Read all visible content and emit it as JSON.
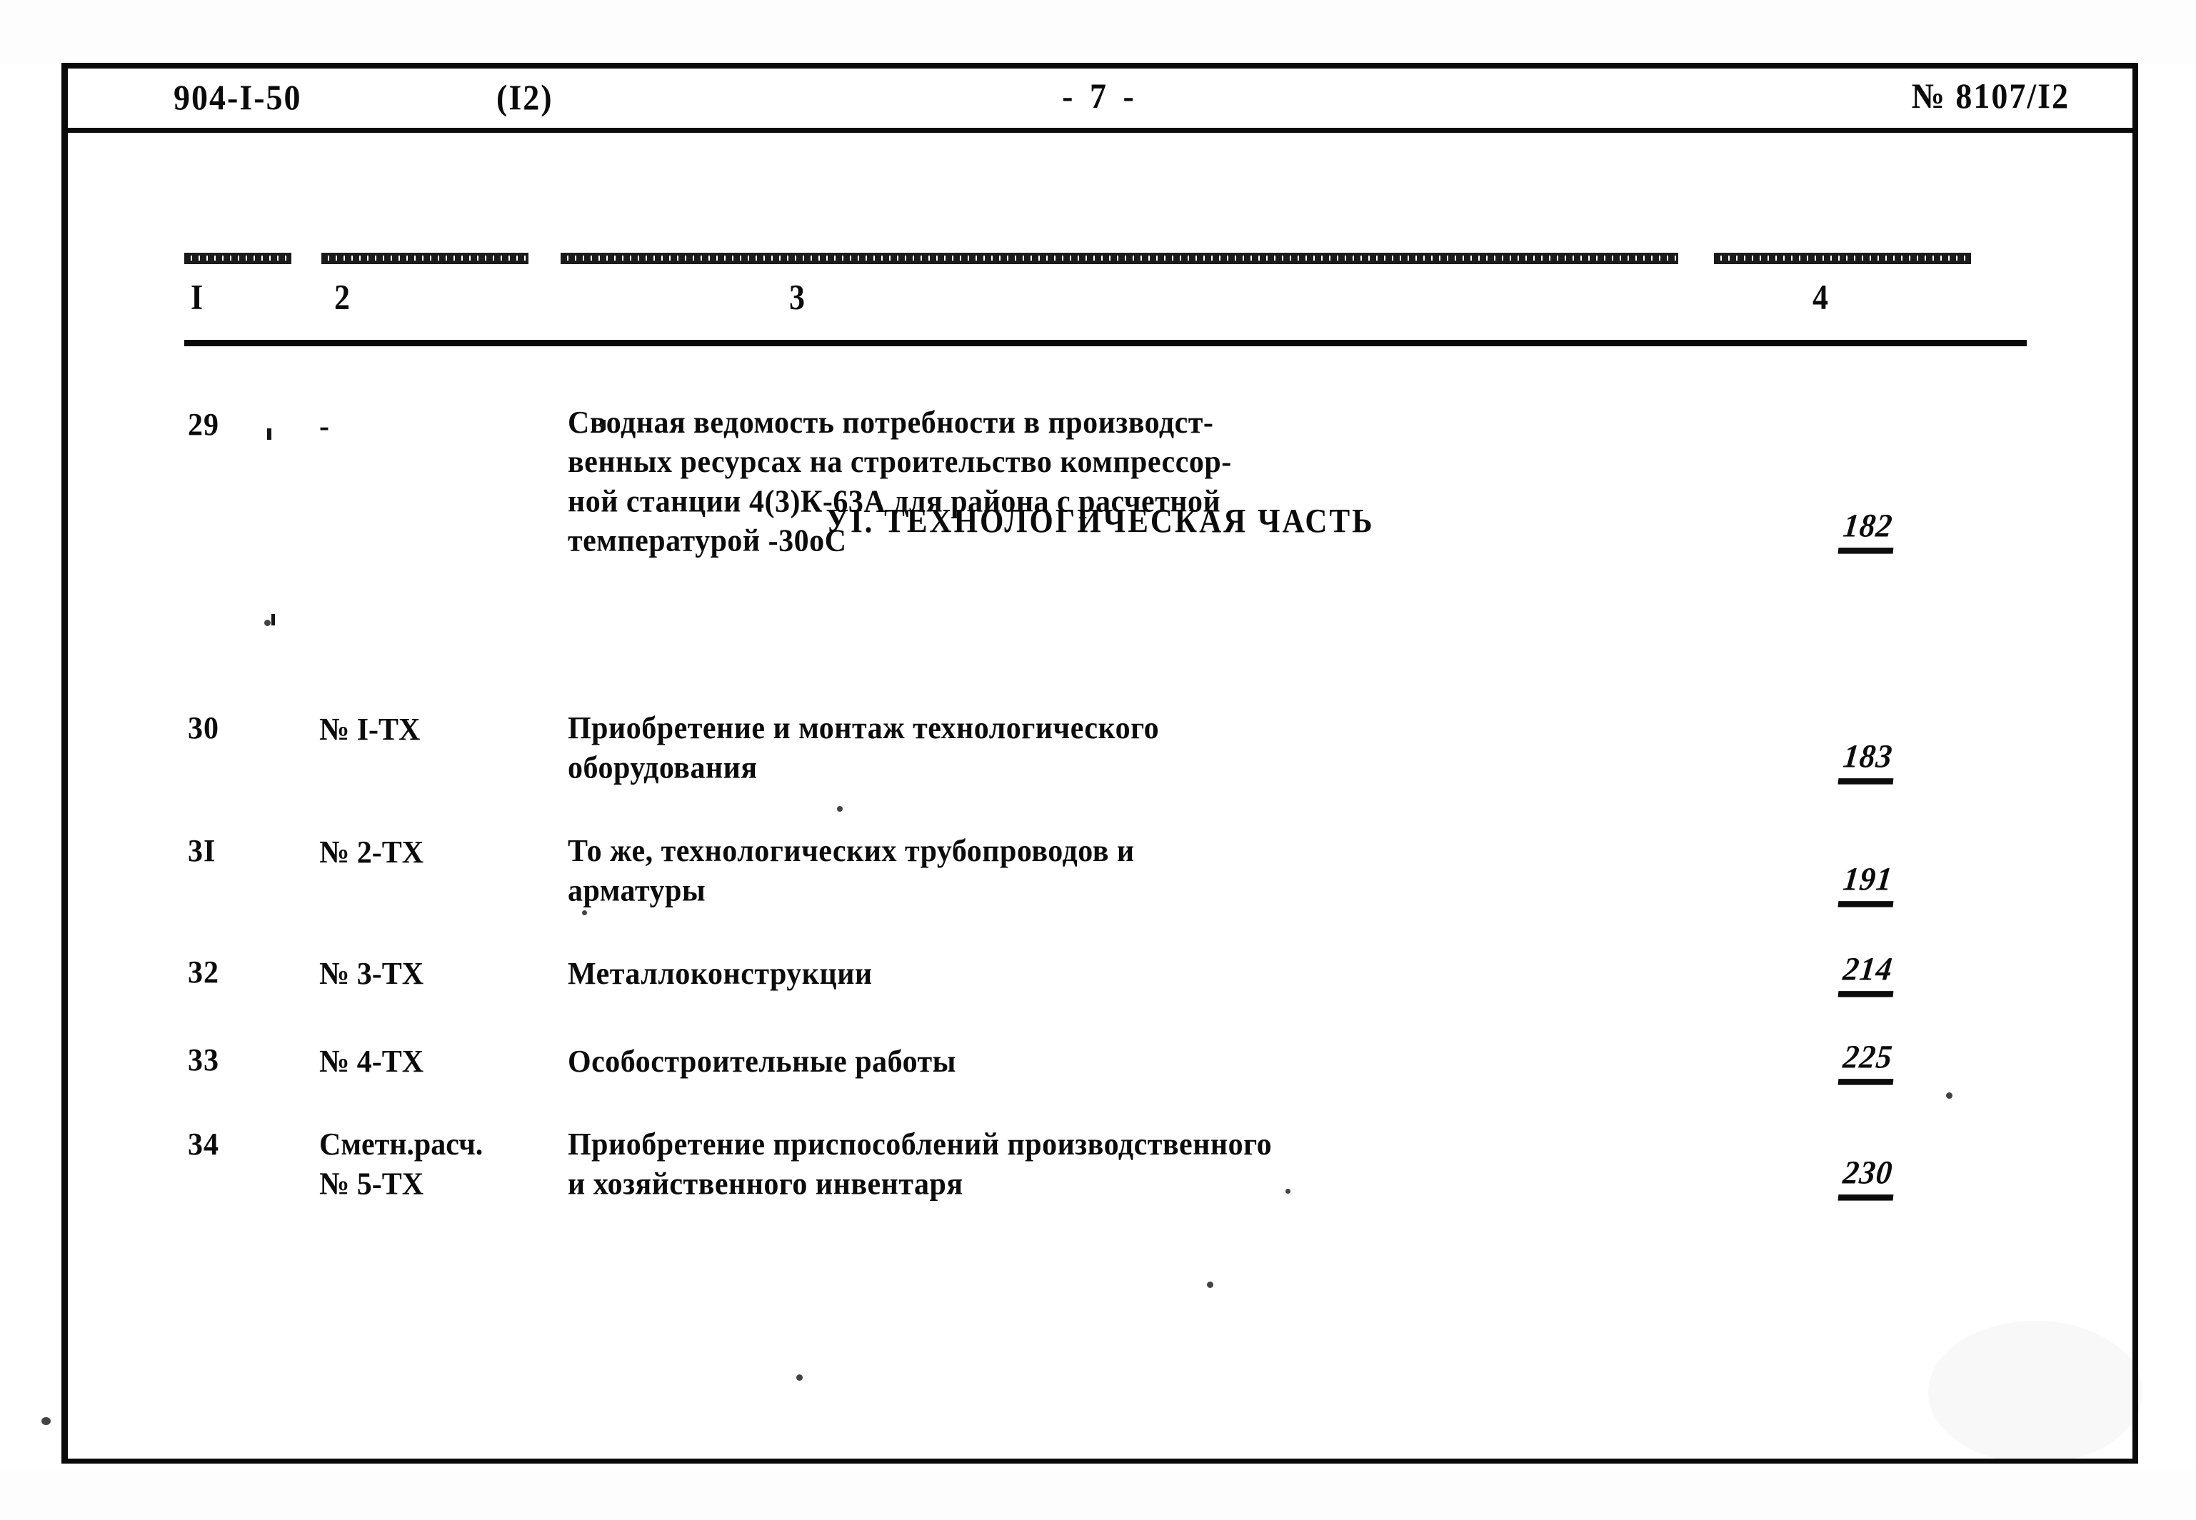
{
  "document": {
    "header": {
      "code": "904-I-50",
      "issue": "(I2)",
      "page_marker": "- 7 -",
      "doc_number": "№ 8107/I2"
    },
    "table": {
      "column_headers": [
        "I",
        "2",
        "3",
        "4"
      ],
      "rows": [
        {
          "num": "29",
          "code": "-",
          "description": "Сводная ведомость потребности в производст-\nвенных ресурсах на строительство компрессор-\nной станции 4(3)К-63А для района с расчетной\nтемпературой -30оС",
          "page": "182"
        },
        {
          "num": "30",
          "code": "№ I-ТХ",
          "description": "Приобретение и монтаж технологического\nоборудования",
          "page": "183"
        },
        {
          "num": "3I",
          "code": "№ 2-ТХ",
          "description": "То же, технологических трубопроводов и\nарматуры",
          "page": "191"
        },
        {
          "num": "32",
          "code": "№ 3-ТХ",
          "description": "Металлоконструкции",
          "page": "214"
        },
        {
          "num": "33",
          "code": "№ 4-ТХ",
          "description": "Особостроительные работы",
          "page": "225"
        },
        {
          "num": "34",
          "code": "Сметн.расч.\n№ 5-ТХ",
          "description": "Приобретение приспособлений производственного\nи хозяйственного инвентаря",
          "page": "230"
        }
      ]
    },
    "section_heading": "УI. ТЕХНОЛОГИЧЕСКАЯ ЧАСТЬ"
  }
}
